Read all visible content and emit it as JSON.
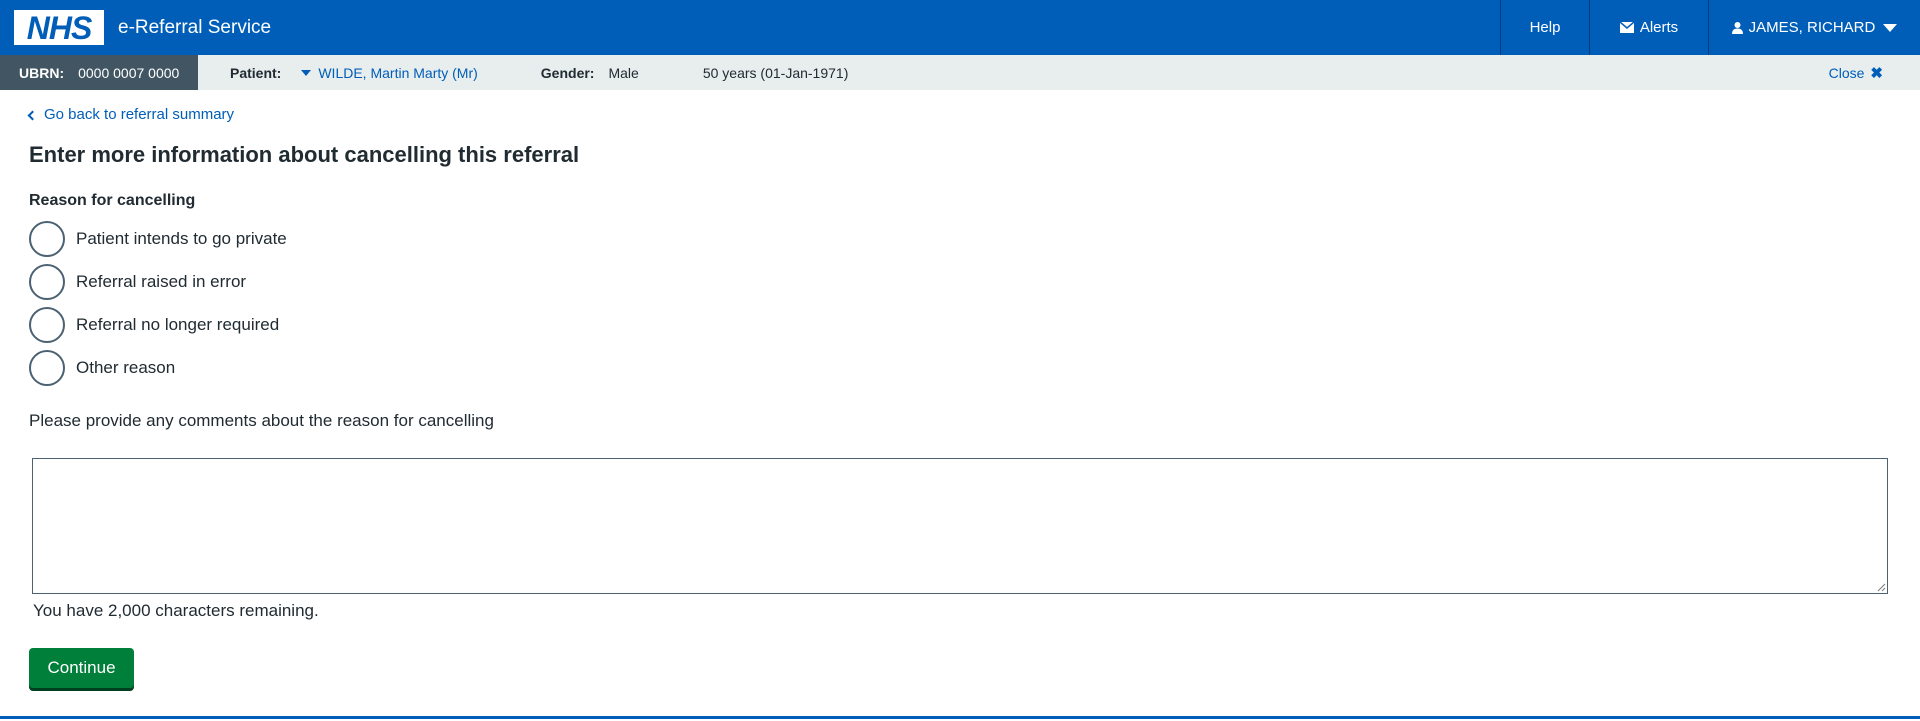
{
  "header": {
    "logo_text": "NHS",
    "service_name": "e-Referral Service",
    "help": "Help",
    "alerts": "Alerts",
    "user": "JAMES, RICHARD",
    "brand_color": "#005eb8"
  },
  "patient_bar": {
    "ubrn_label": "UBRN:",
    "ubrn_value": "0000 0007 0000",
    "patient_label": "Patient:",
    "patient_name": "WILDE, Martin Marty (Mr)",
    "gender_label": "Gender:",
    "gender_value": "Male",
    "age": "50 years (01-Jan-1971)",
    "close": "Close"
  },
  "main": {
    "back_link": "Go back to referral summary",
    "title": "Enter more information about cancelling this referral",
    "reason_label": "Reason for cancelling",
    "reasons": [
      "Patient intends to go private",
      "Referral raised in error",
      "Referral no longer required",
      "Other reason"
    ],
    "comments_label": "Please provide any comments about the reason for cancelling",
    "comments_value": "",
    "remaining": "You have 2,000 characters remaining.",
    "continue": "Continue",
    "continue_color": "#007f3b"
  }
}
